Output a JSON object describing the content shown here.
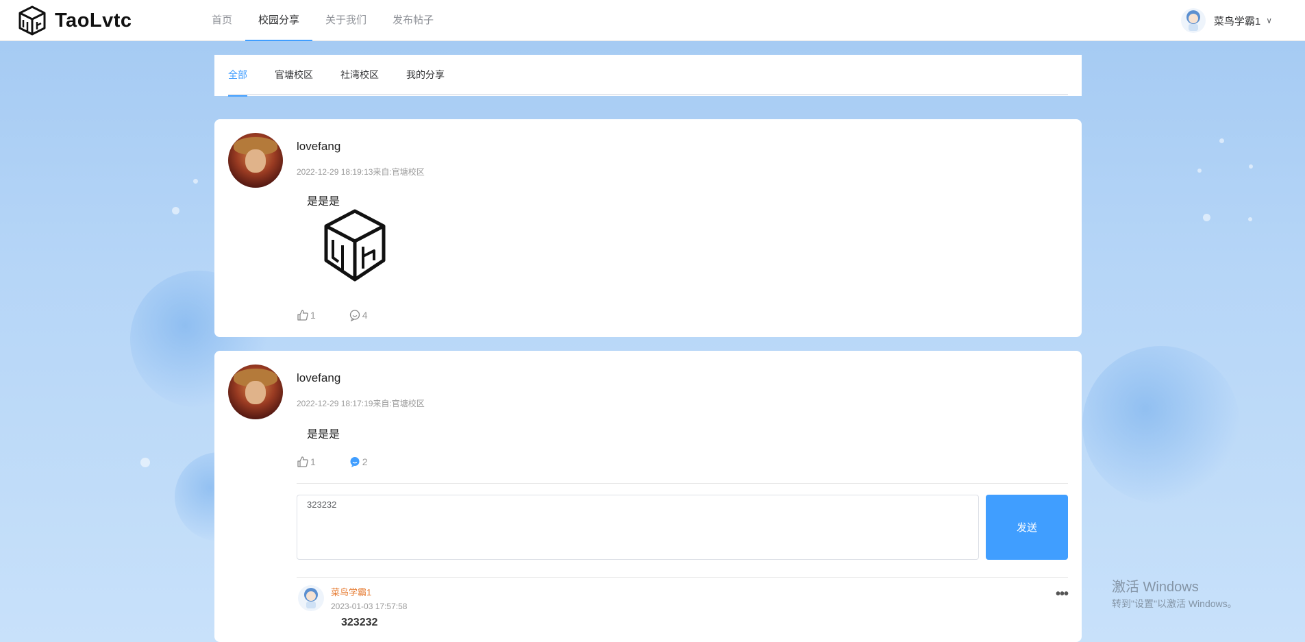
{
  "brand": {
    "name": "TaoLvtc"
  },
  "nav": {
    "items": [
      {
        "label": "首页"
      },
      {
        "label": "校园分享"
      },
      {
        "label": "关于我们"
      },
      {
        "label": "发布帖子"
      }
    ],
    "active_index": 1
  },
  "user": {
    "name": "菜鸟学霸1",
    "caret": "∨"
  },
  "tabs": {
    "items": [
      {
        "label": "全部"
      },
      {
        "label": "官塘校区"
      },
      {
        "label": "社湾校区"
      },
      {
        "label": "我的分享"
      }
    ],
    "active_index": 0
  },
  "posts": [
    {
      "username": "lovefang",
      "meta": "2022-12-29 18:19:13来自:官塘校区",
      "text": "是是是",
      "likes": "1",
      "comments": "4",
      "has_image": true
    },
    {
      "username": "lovefang",
      "meta": "2022-12-29 18:17:19来自:官塘校区",
      "text": "是是是",
      "likes": "1",
      "comments": "2",
      "comment_input": {
        "value": "323232"
      },
      "send_label": "发送",
      "replies": [
        {
          "username": "菜鸟学霸1",
          "time": "2023-01-03 17:57:58",
          "text": "323232"
        }
      ]
    }
  ],
  "watermark": {
    "title": "激活 Windows",
    "subtitle": "转到\"设置\"以激活 Windows。"
  },
  "colors": {
    "accent": "#409eff",
    "reply_user": "#e6792e",
    "background": "#a3c9f2"
  }
}
